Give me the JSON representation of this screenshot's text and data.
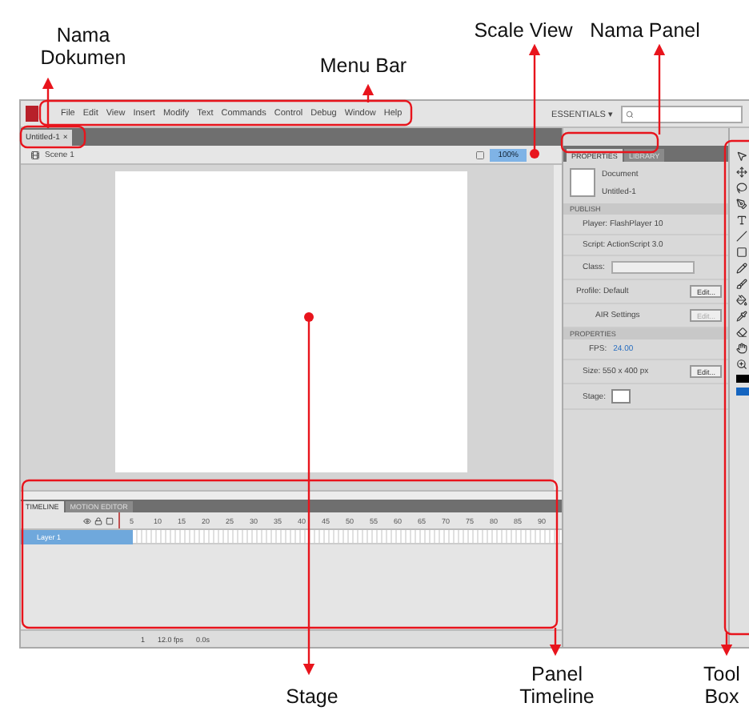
{
  "menu_bar": {
    "items": [
      "File",
      "Edit",
      "View",
      "Insert",
      "Modify",
      "Text",
      "Commands",
      "Control",
      "Debug",
      "Window",
      "Help"
    ],
    "workspace": "ESSENTIALS ▾"
  },
  "document_tab": {
    "label": "Untitled-1",
    "close": "×"
  },
  "scene_bar": {
    "scene": "Scene 1",
    "zoom": "100%"
  },
  "timeline": {
    "tabs": [
      {
        "label": "TIMELINE",
        "selected": true
      },
      {
        "label": "MOTION EDITOR",
        "selected": false
      }
    ],
    "frame_numbers": [
      "5",
      "10",
      "15",
      "20",
      "25",
      "30",
      "35",
      "40",
      "45",
      "50",
      "55",
      "60",
      "65",
      "70",
      "75",
      "80",
      "85",
      "90"
    ],
    "layers": [
      {
        "name": "Layer 1",
        "selected": true
      }
    ],
    "status": [
      "1",
      "12.0 fps",
      "0.0s"
    ]
  },
  "properties_panel": {
    "tabs": [
      {
        "label": "PROPERTIES",
        "selected": true
      },
      {
        "label": "LIBRARY",
        "selected": false
      }
    ],
    "document_label": "Document",
    "document_name": "Untitled-1",
    "publish_heading": "PUBLISH",
    "player": "Player: FlashPlayer 10",
    "script": "Script: ActionScript 3.0",
    "class_label": "Class:",
    "profile": "Profile: Default",
    "profile_edit": "Edit...",
    "air": "AIR Settings",
    "air_edit": "Edit...",
    "properties_heading": "PROPERTIES",
    "fps_label": "FPS:",
    "fps": "24.00",
    "size": "Size: 550 x 400 px",
    "size_edit": "Edit...",
    "stage_label": "Stage:"
  },
  "annotations": [
    {
      "label": "Nama Dokumen"
    },
    {
      "label": "Menu Bar"
    },
    {
      "label": "Scale View"
    },
    {
      "label": "Nama Panel"
    },
    {
      "label": "Stage"
    },
    {
      "label": "Panel Timeline"
    },
    {
      "label": "Tool Box"
    }
  ]
}
